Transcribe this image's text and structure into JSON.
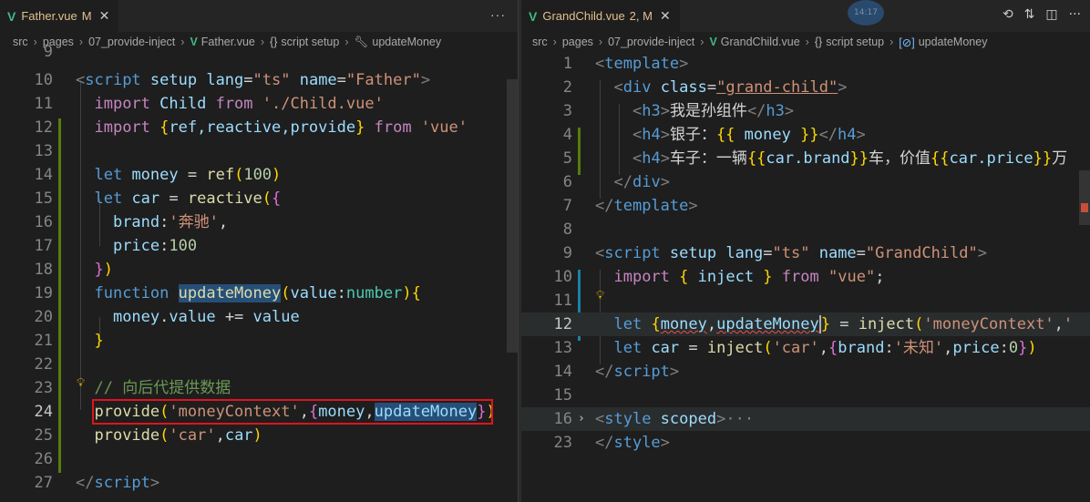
{
  "left": {
    "tab": {
      "icon": "V",
      "name": "Father.vue",
      "badge": "M",
      "close": "✕",
      "more": "···"
    },
    "breadcrumb": [
      "src",
      "pages",
      "07_provide-inject",
      "Father.vue",
      "script setup",
      "updateMoney"
    ],
    "lines": [
      {
        "n": "9"
      },
      {
        "n": "10"
      },
      {
        "n": "11"
      },
      {
        "n": "12"
      },
      {
        "n": "13"
      },
      {
        "n": "14"
      },
      {
        "n": "15"
      },
      {
        "n": "16"
      },
      {
        "n": "17"
      },
      {
        "n": "18"
      },
      {
        "n": "19"
      },
      {
        "n": "20"
      },
      {
        "n": "21"
      },
      {
        "n": "22"
      },
      {
        "n": "23"
      },
      {
        "n": "24"
      },
      {
        "n": "25"
      },
      {
        "n": "26"
      },
      {
        "n": "27"
      }
    ],
    "code": {
      "l10": [
        "<",
        "script",
        " setup ",
        "lang",
        "=",
        "\"ts\"",
        " name",
        "=",
        "\"Father\"",
        ">"
      ],
      "l11": [
        "import",
        " Child ",
        "from",
        " ",
        "'./Child.vue'"
      ],
      "l12": [
        "import",
        " ",
        "{",
        "ref,reactive,provide",
        "}",
        " ",
        "from",
        " ",
        "'vue'"
      ],
      "l14": [
        "let",
        " money ",
        "=",
        " ",
        "ref",
        "(",
        "100",
        ")"
      ],
      "l15": [
        "let",
        " car ",
        "=",
        " ",
        "reactive",
        "(",
        "{"
      ],
      "l16": [
        "brand",
        ":",
        "'奔驰'",
        ","
      ],
      "l17": [
        "price",
        ":",
        "100"
      ],
      "l18": [
        "}",
        ")"
      ],
      "l19": [
        "function",
        " ",
        "updateMoney",
        "(",
        "value",
        ":",
        "number",
        ")",
        "{"
      ],
      "l20": [
        "money",
        ".",
        "value",
        " += ",
        "value"
      ],
      "l21": [
        "}"
      ],
      "l23": [
        "// 向后代提供数据"
      ],
      "l24": [
        "provide",
        "(",
        "'moneyContext'",
        ",",
        "{",
        "money",
        ",",
        "updateMoney",
        "}",
        ")"
      ],
      "l25": [
        "provide",
        "(",
        "'car'",
        ",",
        "car",
        ")"
      ],
      "l27": [
        "</",
        "script",
        ">"
      ]
    }
  },
  "right": {
    "tab": {
      "icon": "V",
      "name": "GrandChild.vue",
      "badge": "2, M",
      "close": "✕"
    },
    "actions": [
      "⟲",
      "⇅",
      "◫",
      "···"
    ],
    "clock": "14:17",
    "breadcrumb": [
      "src",
      "pages",
      "07_provide-inject",
      "GrandChild.vue",
      "script setup",
      "updateMoney"
    ],
    "lines": [
      {
        "n": "1"
      },
      {
        "n": "2"
      },
      {
        "n": "3"
      },
      {
        "n": "4"
      },
      {
        "n": "5"
      },
      {
        "n": "6"
      },
      {
        "n": "7"
      },
      {
        "n": "8"
      },
      {
        "n": "9"
      },
      {
        "n": "10"
      },
      {
        "n": "11"
      },
      {
        "n": "12"
      },
      {
        "n": "13"
      },
      {
        "n": "14"
      },
      {
        "n": "15"
      },
      {
        "n": "16"
      },
      {
        "n": "23"
      }
    ],
    "code": {
      "l1": [
        "<",
        "template",
        ">"
      ],
      "l2": [
        "<",
        "div",
        " class",
        "=",
        "\"grand-child\"",
        ">"
      ],
      "l3": [
        "<",
        "h3",
        ">",
        "我是孙组件",
        "</",
        "h3",
        ">"
      ],
      "l4": [
        "<",
        "h4",
        ">",
        "银子：",
        "{{",
        " money ",
        "}}",
        "</",
        "h4",
        ">"
      ],
      "l5": [
        "<",
        "h4",
        ">",
        "车子：一辆",
        "{{",
        "car.brand",
        "}}",
        "车，价值",
        "{{",
        "car.price",
        "}}",
        "万"
      ],
      "l6": [
        "</",
        "div",
        ">"
      ],
      "l7": [
        "</",
        "template",
        ">"
      ],
      "l9": [
        "<",
        "script",
        " setup ",
        "lang",
        "=",
        "\"ts\"",
        " name",
        "=",
        "\"GrandChild\"",
        ">"
      ],
      "l10": [
        "import",
        " ",
        "{",
        " inject ",
        "}",
        " ",
        "from",
        " ",
        "\"vue\"",
        ";"
      ],
      "l12": [
        "let",
        " ",
        "{",
        "money",
        ",",
        "updateMoney",
        "}",
        " = ",
        "inject",
        "(",
        "'moneyContext'",
        ",",
        "'"
      ],
      "l13": [
        "let",
        " car ",
        "=",
        " ",
        "inject",
        "(",
        "'car'",
        ",",
        "{",
        "brand",
        ":",
        "'未知'",
        ",",
        "price",
        ":",
        "0",
        "}",
        ")"
      ],
      "l14": [
        "</",
        "script",
        ">"
      ],
      "l16": [
        "<",
        "style",
        " scoped",
        ">",
        "···"
      ],
      "l23": [
        "</",
        "style",
        ">"
      ]
    }
  }
}
